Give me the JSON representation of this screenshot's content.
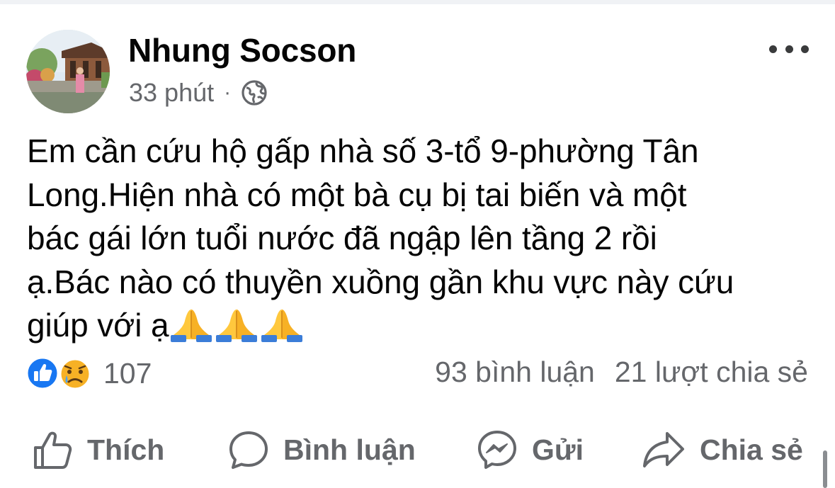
{
  "post": {
    "author": "Nhung Socson",
    "time": "33 phút",
    "separator": "·",
    "privacy_icon": "globe-icon",
    "text_lines": [
      "Em cần cứu hộ gấp nhà số 3-tổ 9-phường Tân",
      "Long.Hiện nhà có một bà cụ bị tai biến và một",
      "bác gái lớn tuổi nước đã ngập lên tầng 2 rồi",
      "ạ.Bác nào có thuyền xuồng gần khu vực này cứu",
      "giúp với ạ"
    ],
    "emoji": "folded-hands x3"
  },
  "reactions": {
    "icons": [
      "like-icon",
      "sad-icon"
    ],
    "count": "107",
    "comments": "93 bình luận",
    "shares": "21 lượt chia sẻ"
  },
  "actions": {
    "like": "Thích",
    "comment": "Bình luận",
    "send": "Gửi",
    "share": "Chia sẻ"
  },
  "colors": {
    "text": "#050505",
    "secondary": "#65676b",
    "like_blue": "#1877f2",
    "sad_yellow": "#f7b125"
  }
}
